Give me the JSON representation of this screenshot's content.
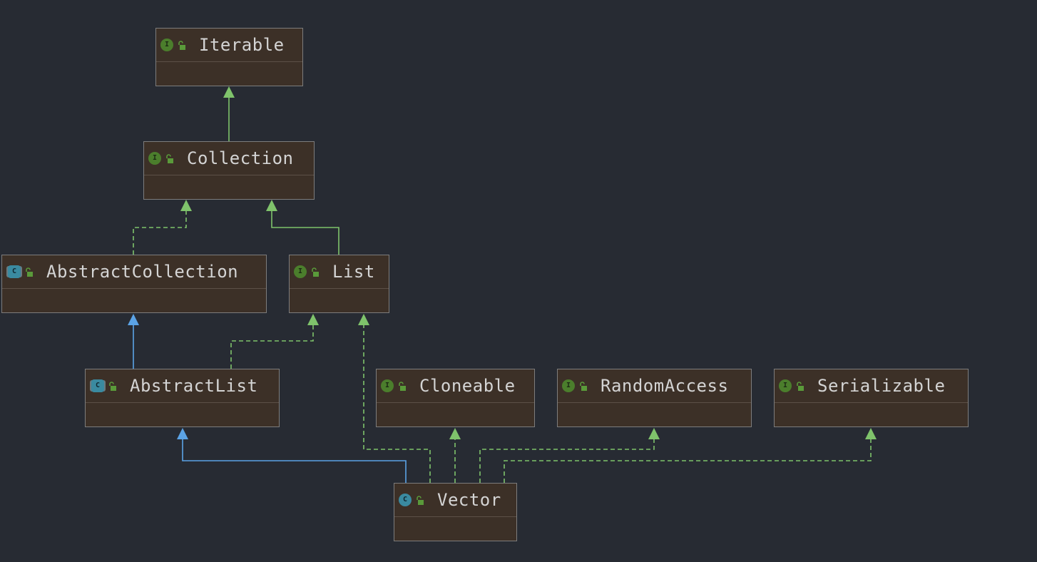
{
  "diagram": {
    "background": "#272b33",
    "node_fill": "#3c3027",
    "node_border": "#7d7d7d",
    "colors": {
      "implements": "#7fc36b",
      "extends_class": "#5ba3e6",
      "interface_badge": "#4b7e2c",
      "class_badge": "#3a8aa0"
    },
    "nodes": [
      {
        "id": "iterable",
        "name": "Iterable",
        "kind": "interface",
        "badge_letter": "I",
        "visibility_icon": "unlock-icon"
      },
      {
        "id": "collection",
        "name": "Collection",
        "kind": "interface",
        "badge_letter": "I",
        "visibility_icon": "unlock-icon"
      },
      {
        "id": "abstract-collection",
        "name": "AbstractCollection",
        "kind": "abstract-class",
        "badge_letter": "C",
        "visibility_icon": "unlock-icon"
      },
      {
        "id": "list",
        "name": "List",
        "kind": "interface",
        "badge_letter": "I",
        "visibility_icon": "unlock-icon"
      },
      {
        "id": "abstract-list",
        "name": "AbstractList",
        "kind": "abstract-class",
        "badge_letter": "C",
        "visibility_icon": "unlock-icon"
      },
      {
        "id": "cloneable",
        "name": "Cloneable",
        "kind": "interface",
        "badge_letter": "I",
        "visibility_icon": "unlock-icon"
      },
      {
        "id": "random-access",
        "name": "RandomAccess",
        "kind": "interface",
        "badge_letter": "I",
        "visibility_icon": "unlock-icon"
      },
      {
        "id": "serializable",
        "name": "Serializable",
        "kind": "interface",
        "badge_letter": "I",
        "visibility_icon": "unlock-icon"
      },
      {
        "id": "vector",
        "name": "Vector",
        "kind": "class",
        "badge_letter": "C",
        "visibility_icon": "unlock-icon"
      }
    ],
    "edges": [
      {
        "from": "collection",
        "to": "iterable",
        "relation": "extends",
        "style": "solid",
        "color": "#7fc36b"
      },
      {
        "from": "abstract-collection",
        "to": "collection",
        "relation": "implements",
        "style": "dashed",
        "color": "#7fc36b"
      },
      {
        "from": "list",
        "to": "collection",
        "relation": "extends",
        "style": "solid",
        "color": "#7fc36b"
      },
      {
        "from": "abstract-list",
        "to": "abstract-collection",
        "relation": "extends",
        "style": "solid",
        "color": "#5ba3e6"
      },
      {
        "from": "abstract-list",
        "to": "list",
        "relation": "implements",
        "style": "dashed",
        "color": "#7fc36b"
      },
      {
        "from": "vector",
        "to": "abstract-list",
        "relation": "extends",
        "style": "solid",
        "color": "#5ba3e6"
      },
      {
        "from": "vector",
        "to": "list",
        "relation": "implements",
        "style": "dashed",
        "color": "#7fc36b"
      },
      {
        "from": "vector",
        "to": "cloneable",
        "relation": "implements",
        "style": "dashed",
        "color": "#7fc36b"
      },
      {
        "from": "vector",
        "to": "random-access",
        "relation": "implements",
        "style": "dashed",
        "color": "#7fc36b"
      },
      {
        "from": "vector",
        "to": "serializable",
        "relation": "implements",
        "style": "dashed",
        "color": "#7fc36b"
      }
    ]
  }
}
